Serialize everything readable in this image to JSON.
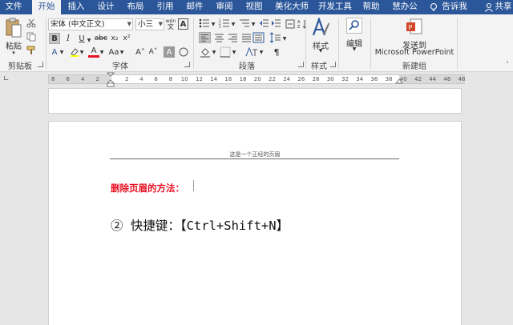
{
  "tabs": {
    "file": "文件",
    "home": "开始",
    "insert": "插入",
    "design": "设计",
    "layout": "布局",
    "references": "引用",
    "mailings": "邮件",
    "review": "审阅",
    "view": "视图",
    "meihua": "美化大师",
    "developer": "开发工具",
    "help": "帮助",
    "huibangong": "慧办公",
    "tell": "告诉我",
    "share": "共享"
  },
  "ribbon": {
    "clipboard": {
      "paste_label": "粘贴",
      "group_label": "剪贴板"
    },
    "font": {
      "font_name": "宋体 (中文正文)",
      "font_size": "小三",
      "group_label": "字体",
      "wen_glyph": "wén",
      "wen_char": "文",
      "bold": "B",
      "italic": "I",
      "underline": "U",
      "strike": "abc",
      "subscript": "x₂",
      "superscript": "x²",
      "a_glyph": "A",
      "aa_glyph": "Aa",
      "grow": "A˄",
      "shrink": "A˅"
    },
    "paragraph": {
      "group_label": "段落"
    },
    "styles": {
      "style_label": "样式",
      "group_label": "样式"
    },
    "editing": {
      "edit_label": "编辑"
    },
    "newgroup": {
      "send_line1": "发送到",
      "send_line2": "Microsoft PowerPoint",
      "group_label": "新建组"
    }
  },
  "ruler": {
    "left_numbers": [
      "8",
      "6",
      "4",
      "2"
    ],
    "right_numbers": [
      "2",
      "4",
      "6",
      "8",
      "10",
      "12",
      "14",
      "16",
      "18",
      "20",
      "22",
      "24",
      "26",
      "28",
      "30",
      "32",
      "34",
      "36",
      "38",
      "40",
      "42",
      "44",
      "46",
      "48"
    ]
  },
  "document": {
    "header_text": "这是一个正经的页眉",
    "red_heading": "删除页眉的方法：",
    "shortcut_line": "②  快捷键：【Ctrl+Shift+N】"
  },
  "colors": {
    "tab_bar": "#2b579a",
    "heading_red": "#e81123"
  }
}
